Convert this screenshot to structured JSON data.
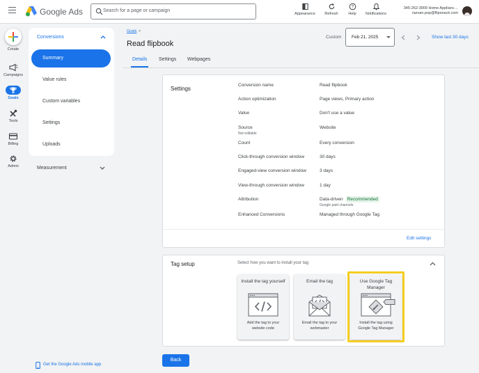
{
  "header": {
    "brand": "Google Ads",
    "search_placeholder": "Search for a page or campaign",
    "tools": [
      {
        "label": "Appearance",
        "icon": "appearance-icon"
      },
      {
        "label": "Refresh",
        "icon": "refresh-icon"
      },
      {
        "label": "Help",
        "icon": "help-icon"
      },
      {
        "label": "Notifications",
        "icon": "bell-icon"
      }
    ],
    "account": {
      "id_name": "345-262-3909 Home Applianc…",
      "email": "razvan.pop@flipsnack.com"
    }
  },
  "rail": {
    "create": "Create",
    "items": [
      {
        "label": "Campaigns",
        "icon": "megaphone-icon"
      },
      {
        "label": "Goals",
        "icon": "trophy-icon"
      },
      {
        "label": "Tools",
        "icon": "tools-icon"
      },
      {
        "label": "Billing",
        "icon": "credit-card-icon"
      },
      {
        "label": "Admin",
        "icon": "gear-icon"
      }
    ]
  },
  "sidebar": {
    "section": "Conversions",
    "items": [
      {
        "label": "Summary"
      },
      {
        "label": "Value rules"
      },
      {
        "label": "Custom variables"
      },
      {
        "label": "Settings"
      },
      {
        "label": "Uploads"
      }
    ],
    "measurement": "Measurement",
    "mobile_app": "Get the Google Ads mobile app"
  },
  "page": {
    "breadcrumb": "Goals",
    "breadcrumb_sep": ">",
    "title": "Read flipbook",
    "tabs": [
      {
        "label": "Details"
      },
      {
        "label": "Settings"
      },
      {
        "label": "Webpages"
      }
    ],
    "custom_label": "Custom",
    "date": "Feb 21, 2025",
    "show_last": "Show last 30 days"
  },
  "settings_card": {
    "title": "Settings",
    "rows": [
      {
        "label": "Conversion name",
        "value": "Read flipbook"
      },
      {
        "label": "Action optimization",
        "value": "Page views, Primary action"
      },
      {
        "label": "Value",
        "value": "Don't use a value"
      },
      {
        "label": "Source",
        "value": "Website",
        "note": "Not editable"
      },
      {
        "label": "Count",
        "value": "Every conversion"
      },
      {
        "label": "Click-through conversion window",
        "value": "30 days"
      },
      {
        "label": "Engaged-view conversion window",
        "value": "3 days"
      },
      {
        "label": "View-through conversion window",
        "value": "1 day"
      },
      {
        "label": "Attribution",
        "value": "Data-driven",
        "badge": "Recommended",
        "note": "Google paid channels"
      },
      {
        "label": "Enhanced Conversions",
        "value": "Managed through Google Tag."
      }
    ],
    "edit": "Edit settings"
  },
  "tag_card": {
    "title": "Tag setup",
    "hint": "Select how you want to install your tag",
    "options": [
      {
        "title": "Install the tag yourself",
        "desc": "Add the tag to your website code",
        "icon": "code-window-icon"
      },
      {
        "title": "Email the tag",
        "desc": "Email the tag to your webmaster",
        "icon": "email-code-icon"
      },
      {
        "title": "Use Google Tag Manager",
        "desc": "Install the tag using Google Tag Manager",
        "icon": "tag-manager-icon"
      }
    ]
  },
  "footer": {
    "back": "Back"
  },
  "colors": {
    "accent": "#1a73e8",
    "highlight": "#f5cd21",
    "badge_bg": "#e6f4ea",
    "badge_fg": "#137333"
  }
}
